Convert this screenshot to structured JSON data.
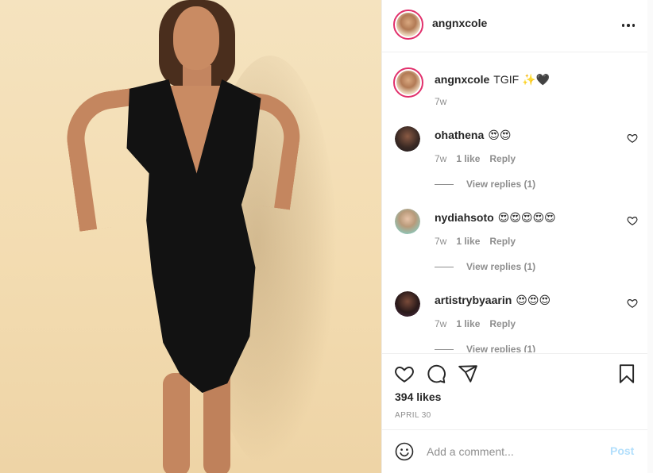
{
  "post": {
    "username": "angnxcole",
    "caption_text": "TGIF",
    "caption_emoji": "✨🖤",
    "caption_age": "7w"
  },
  "comments": [
    {
      "username": "ohathena",
      "emoji": "😍😍",
      "age": "7w",
      "likes": "1 like",
      "reply_label": "Reply",
      "view_replies": "View replies (1)"
    },
    {
      "username": "nydiahsoto",
      "emoji": "😍😍😍😍😍",
      "age": "7w",
      "likes": "1 like",
      "reply_label": "Reply",
      "view_replies": "View replies (1)"
    },
    {
      "username": "artistrybyaarin",
      "emoji": "😍😍😍",
      "age": "7w",
      "likes": "1 like",
      "reply_label": "Reply",
      "view_replies": "View replies (1)"
    }
  ],
  "stats": {
    "likes": "394 likes",
    "date": "APRIL 30"
  },
  "composer": {
    "placeholder": "Add a comment...",
    "post_label": "Post"
  },
  "icons": {
    "more": "more-options-icon",
    "like": "heart-icon",
    "comment": "comment-icon",
    "share": "share-icon",
    "save": "bookmark-icon",
    "emoji": "smile-icon"
  },
  "colors": {
    "story_ring": "#e1306c",
    "post_disabled": "#b2dffc",
    "muted_text": "#8e8e8e"
  }
}
